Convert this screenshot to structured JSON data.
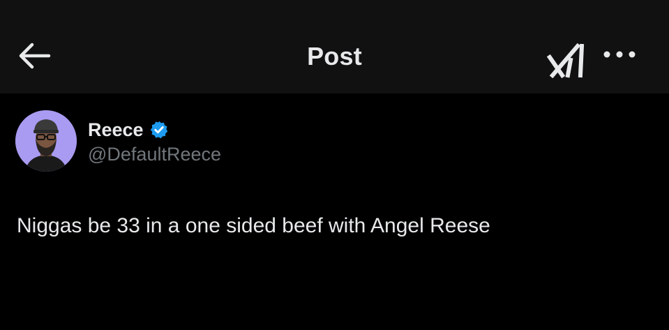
{
  "header": {
    "title": "Post",
    "back_icon": "arrow-left-icon",
    "grok_icon": "grok-icon",
    "more_icon": "more-horizontal-icon"
  },
  "post": {
    "author": {
      "display_name": "Reece",
      "handle": "@DefaultReece",
      "verified": true,
      "verified_icon": "verified-badge-icon",
      "avatar_bg": "#a99bf2"
    },
    "text": "Niggas be 33 in a one sided beef with Angel Reese"
  },
  "colors": {
    "background": "#000000",
    "header_bg": "#111111",
    "primary_text": "#e7e9ea",
    "secondary_text": "#71767b",
    "verified_blue": "#1d9bf0"
  }
}
